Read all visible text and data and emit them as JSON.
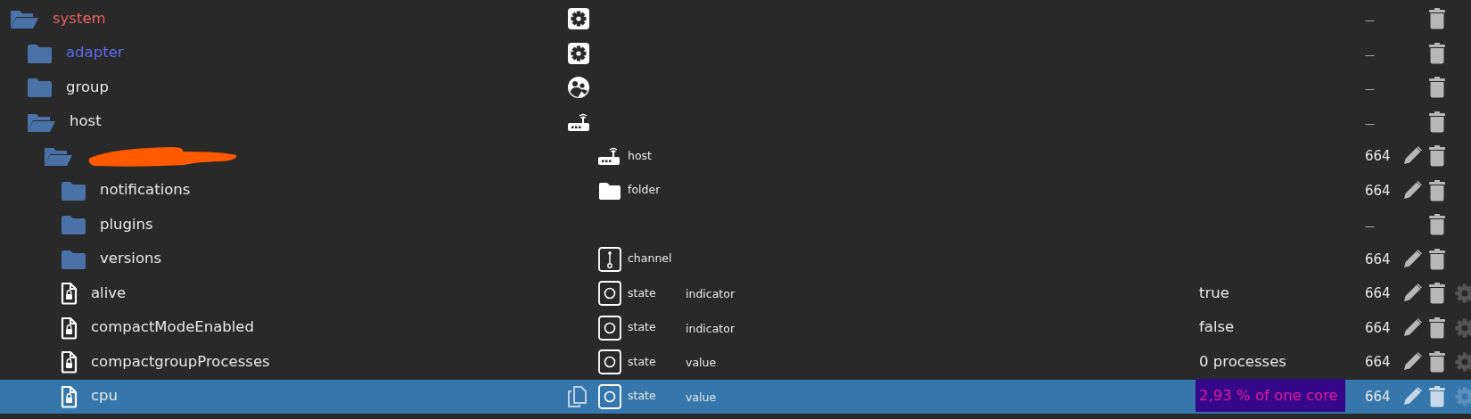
{
  "tree": [
    {
      "name": "system",
      "kind": "open-folder",
      "color": "#e8625f",
      "object_icon": {
        "kind": "gear"
      },
      "rights": "—",
      "delete": true,
      "edit": false,
      "settings": false,
      "selected": false,
      "children": [
        {
          "name": "adapter",
          "kind": "folder",
          "color": "#5a6cf0",
          "object_icon": {
            "kind": "gear"
          },
          "rights": "—",
          "delete": true,
          "edit": false,
          "settings": false,
          "selected": false
        },
        {
          "name": "group",
          "kind": "folder",
          "color": "#e8e8e8",
          "object_icon": {
            "kind": "people"
          },
          "rights": "—",
          "delete": true,
          "edit": false,
          "settings": false,
          "selected": false
        },
        {
          "name": "host",
          "kind": "open-folder",
          "color": "#e8e8e8",
          "object_icon": {
            "kind": "router"
          },
          "rights": "—",
          "delete": true,
          "edit": false,
          "settings": false,
          "selected": false,
          "children": [
            {
              "redacted": true,
              "kind": "open-folder",
              "type": {
                "kind": "router",
                "label": "host"
              },
              "rights": "664",
              "delete": true,
              "edit": true,
              "settings": false,
              "selected": false,
              "children": [
                {
                  "name": "notifications",
                  "kind": "folder",
                  "color": "#e8e8e8",
                  "type": {
                    "kind": "folder",
                    "label": "folder"
                  },
                  "rights": "664",
                  "delete": true,
                  "edit": true,
                  "settings": false,
                  "selected": false
                },
                {
                  "name": "plugins",
                  "kind": "folder",
                  "color": "#e8e8e8",
                  "rights": "—",
                  "delete": true,
                  "edit": false,
                  "settings": false,
                  "selected": false
                },
                {
                  "name": "versions",
                  "kind": "folder",
                  "color": "#e8e8e8",
                  "type": {
                    "kind": "channel",
                    "label": "channel"
                  },
                  "rights": "664",
                  "delete": true,
                  "edit": true,
                  "settings": false,
                  "selected": false
                },
                {
                  "name": "alive",
                  "kind": "state",
                  "color": "#e8e8e8",
                  "type": {
                    "kind": "state",
                    "label": "state"
                  },
                  "role": "indicator",
                  "value": "true",
                  "rights": "664",
                  "delete": true,
                  "edit": true,
                  "settings": true,
                  "selected": false
                },
                {
                  "name": "compactModeEnabled",
                  "kind": "state",
                  "color": "#e8e8e8",
                  "type": {
                    "kind": "state",
                    "label": "state"
                  },
                  "role": "indicator",
                  "value": "false",
                  "rights": "664",
                  "delete": true,
                  "edit": true,
                  "settings": true,
                  "selected": false
                },
                {
                  "name": "compactgroupProcesses",
                  "kind": "state",
                  "color": "#e8e8e8",
                  "type": {
                    "kind": "state",
                    "label": "state"
                  },
                  "role": "value",
                  "value": "0 processes",
                  "rights": "664",
                  "delete": true,
                  "edit": true,
                  "settings": true,
                  "selected": false
                },
                {
                  "name": "cpu",
                  "kind": "state",
                  "color": "#e8e8e8",
                  "type": {
                    "kind": "state",
                    "label": "state"
                  },
                  "role": "value",
                  "value": "2,93 % of one core",
                  "value_highlighted": true,
                  "rights": "664",
                  "delete": true,
                  "edit": true,
                  "settings": true,
                  "selected": true
                }
              ]
            }
          ]
        }
      ]
    }
  ]
}
